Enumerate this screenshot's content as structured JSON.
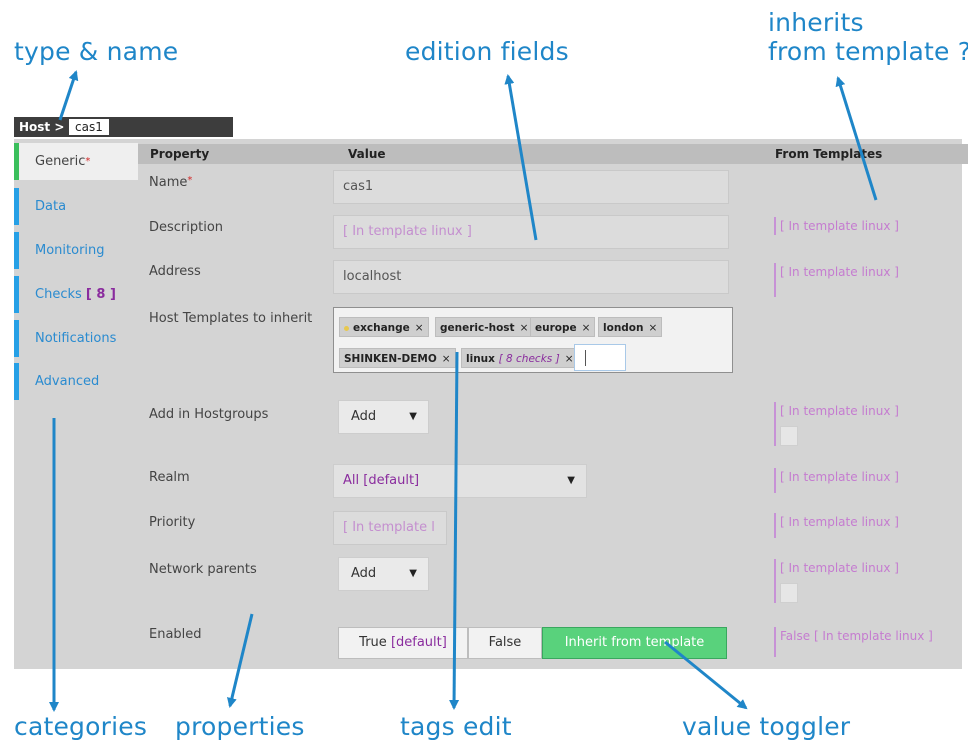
{
  "annotations": {
    "type_name": "type & name",
    "edition_fields": "edition fields",
    "inherits_line1": "inherits",
    "inherits_line2": "from template ?",
    "categories": "categories",
    "properties": "properties",
    "tags_edit": "tags edit",
    "value_toggler": "value toggler"
  },
  "header": {
    "type": "Host >",
    "name": "cas1"
  },
  "sidebar": {
    "items": [
      {
        "label": "Generic",
        "active": true,
        "required": "*"
      },
      {
        "label": "Data"
      },
      {
        "label": "Monitoring"
      },
      {
        "label": "Checks",
        "count": "[ 8 ]"
      },
      {
        "label": "Notifications"
      },
      {
        "label": "Advanced"
      }
    ]
  },
  "columns": {
    "property": "Property",
    "value": "Value",
    "from_templates": "From Templates"
  },
  "rows": {
    "name": {
      "label": "Name",
      "required": "*",
      "value": "cas1"
    },
    "description": {
      "label": "Description",
      "placeholder": "[ In template linux ]",
      "template": "[ In template linux ]"
    },
    "address": {
      "label": "Address",
      "value": "localhost",
      "template": "[ In template linux ]"
    },
    "host_templates": {
      "label": "Host Templates to inherit",
      "tags": [
        "exchange",
        "generic-host",
        "europe",
        "london",
        "SHINKEN-DEMO",
        "linux"
      ],
      "linux_checks": "[ 8 checks ]",
      "remove": "×"
    },
    "hostgroups": {
      "label": "Add in Hostgroups",
      "button": "Add",
      "template": "[ In template linux ]"
    },
    "realm": {
      "label": "Realm",
      "value": "All [default]",
      "template": "[ In template linux ]"
    },
    "priority": {
      "label": "Priority",
      "placeholder": "[ In template l",
      "template": "[ In template linux ]"
    },
    "network_parents": {
      "label": "Network parents",
      "button": "Add",
      "template": "[ In template linux ]"
    },
    "enabled": {
      "label": "Enabled",
      "true_label": "True",
      "true_default": "[default]",
      "false_label": "False",
      "inherit_label": "Inherit from template",
      "template": "False [ In template linux ]"
    }
  },
  "colors": {
    "accent": "#1f86c8",
    "active_green": "#3bbf5c",
    "toggle_on": "#59d27c",
    "template_purple": "#c57cd0"
  }
}
